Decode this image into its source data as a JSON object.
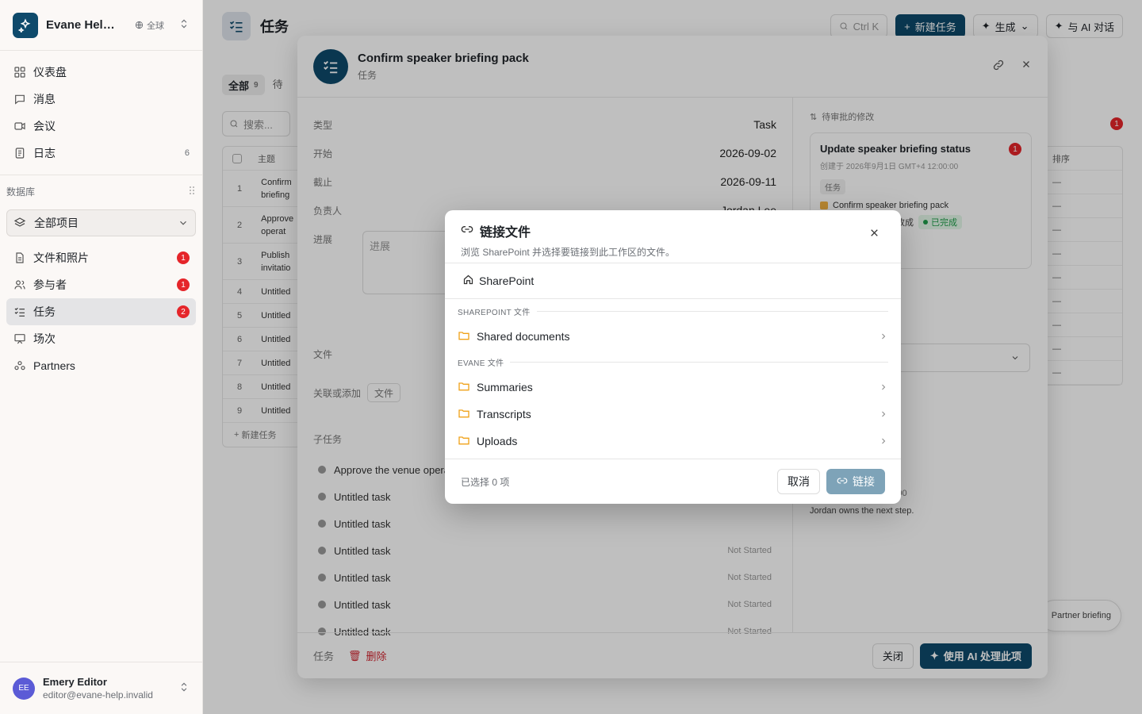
{
  "workspace": {
    "name": "Evane Help Center",
    "scope": "全球"
  },
  "nav": {
    "items": [
      {
        "label": "仪表盘",
        "icon": "dashboard-icon"
      },
      {
        "label": "消息",
        "icon": "message-icon"
      },
      {
        "label": "会议",
        "icon": "video-icon"
      },
      {
        "label": "日志",
        "icon": "log-icon",
        "count": "6"
      }
    ]
  },
  "database": {
    "section_label": "数据库",
    "selector": "全部项目",
    "items": [
      {
        "label": "文件和照片",
        "badge": "1"
      },
      {
        "label": "参与者",
        "badge": "1"
      },
      {
        "label": "任务",
        "badge": "2"
      },
      {
        "label": "场次"
      },
      {
        "label": "Partners"
      }
    ]
  },
  "user": {
    "initials": "EE",
    "name": "Emery Editor",
    "email": "editor@evane-help.invalid"
  },
  "page": {
    "title": "任务",
    "search_shortcut": "Ctrl K",
    "new_task": "新建任务",
    "generate": "生成",
    "ai_chat": "与 AI 对话",
    "tab_all": "全部",
    "tab_all_count": "9",
    "tab_next": "待",
    "search_placeholder": "搜索...",
    "col_subject": "主题",
    "col_last": "排序",
    "rows": [
      {
        "n": "1",
        "name": "Confirm briefing"
      },
      {
        "n": "2",
        "name": "Approve operat"
      },
      {
        "n": "3",
        "name": "Publish invitatio"
      },
      {
        "n": "4",
        "name": "Untitled"
      },
      {
        "n": "5",
        "name": "Untitled"
      },
      {
        "n": "6",
        "name": "Untitled"
      },
      {
        "n": "7",
        "name": "Untitled"
      },
      {
        "n": "8",
        "name": "Untitled"
      },
      {
        "n": "9",
        "name": "Untitled"
      }
    ],
    "new_row": "新建任务",
    "right_badge": "1",
    "partner_pill": "Partner briefing"
  },
  "task": {
    "title": "Confirm speaker briefing pack",
    "subtitle": "任务",
    "props": {
      "type_label": "类型",
      "type_value": "Task",
      "start_label": "开始",
      "start_value": "2026-09-02",
      "due_label": "截止",
      "due_value": "2026-09-11",
      "assignee_label": "负责人",
      "assignee_value": "Jordan Lee",
      "progress_label": "进展",
      "progress_placeholder": "进展",
      "files_label": "文件"
    },
    "link_label": "关联或添加",
    "link_chip": "文件",
    "subtasks_label": "子任务",
    "subtasks": [
      {
        "name": "Approve the venue operations plan",
        "status": ""
      },
      {
        "name": "Untitled task",
        "status": ""
      },
      {
        "name": "Untitled task",
        "status": ""
      },
      {
        "name": "Untitled task",
        "status": "Not Started"
      },
      {
        "name": "Untitled task",
        "status": "Not Started"
      },
      {
        "name": "Untitled task",
        "status": "Not Started"
      },
      {
        "name": "Untitled task",
        "status": "Not Started"
      }
    ],
    "pending_label": "待审批的修改",
    "change": {
      "title": "Update speaker briefing status",
      "badge": "1",
      "meta": "创建于 2026年9月1日 GMT+4 12:00:00",
      "tag": "任务",
      "target": "Confirm speaker briefing pack",
      "action": "改成",
      "status": "已完成"
    },
    "comments": [
      {
        "meta": "9月1日 GMT+4 12:00",
        "text": "e final briefing owner."
      },
      {
        "meta": "nin  9月1日 GMT+4 12:00",
        "text": "Jordan owns the next step."
      }
    ],
    "footer": {
      "type": "任务",
      "delete": "删除",
      "close": "关闭",
      "ai": "使用 AI 处理此项"
    }
  },
  "dialog": {
    "title": "链接文件",
    "description": "浏览 SharePoint 并选择要链接到此工作区的文件。",
    "breadcrumb": "SharePoint",
    "groups": [
      {
        "label": "SHAREPOINT 文件",
        "folders": [
          "Shared documents"
        ]
      },
      {
        "label": "EVANE 文件",
        "folders": [
          "Summaries",
          "Transcripts",
          "Uploads"
        ]
      }
    ],
    "selected_count": "已选择 0 项",
    "cancel": "取消",
    "link": "链接"
  },
  "colors": {
    "brand": "#0e4a6b",
    "badge": "#e5252a",
    "folder": "#f0a21a",
    "link_disabled": "#7ea3b8"
  }
}
